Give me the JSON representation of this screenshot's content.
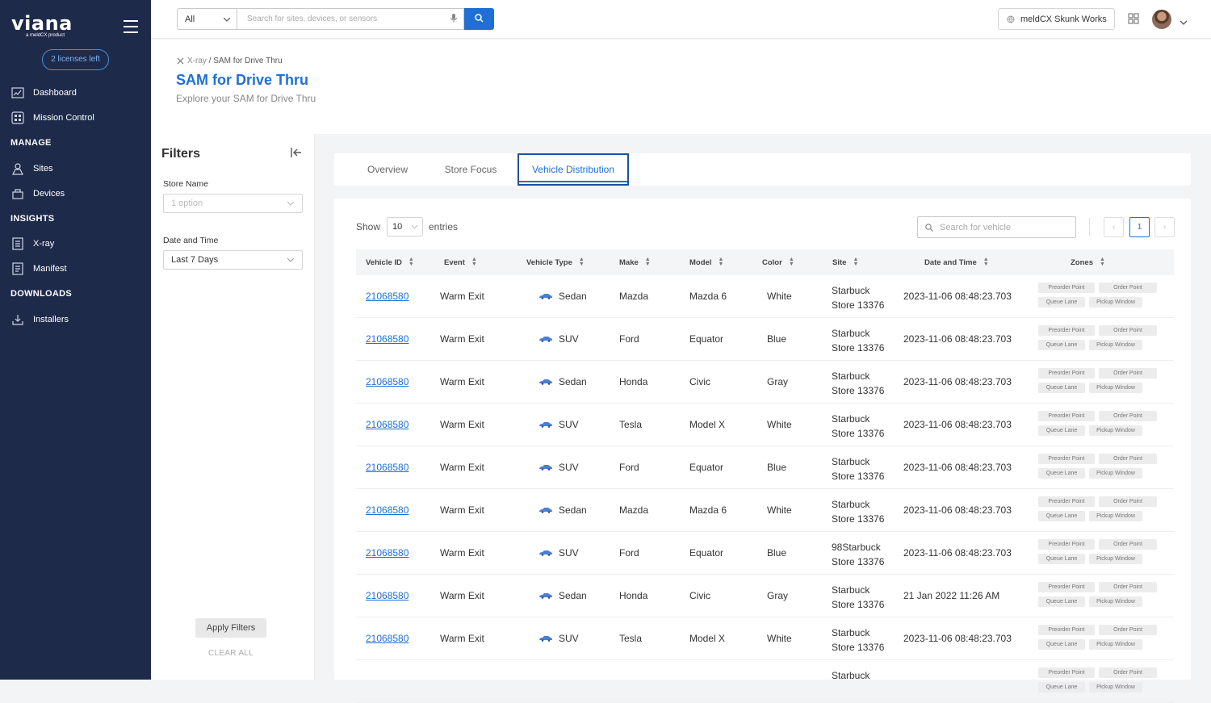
{
  "sidebar": {
    "logo": "viana",
    "logo_sub": "a meldCX product",
    "licenses": "2 licenses left",
    "items_top": [
      {
        "label": "Dashboard",
        "icon": "dashboard-icon"
      },
      {
        "label": "Mission Control",
        "icon": "mission-control-icon"
      }
    ],
    "manage": {
      "title": "MANAGE",
      "items": [
        {
          "label": "Sites",
          "icon": "sites-icon"
        },
        {
          "label": "Devices",
          "icon": "devices-icon"
        }
      ]
    },
    "insights": {
      "title": "INSIGHTS",
      "items": [
        {
          "label": "X-ray",
          "icon": "xray-icon"
        },
        {
          "label": "Manifest",
          "icon": "manifest-icon"
        }
      ]
    },
    "downloads": {
      "title": "DOWNLOADS",
      "items": [
        {
          "label": "Installers",
          "icon": "installers-icon"
        }
      ]
    }
  },
  "topbar": {
    "scope_value": "All",
    "search_placeholder": "Search for sites, devices, or sensors",
    "org_name": "meldCX Skunk Works"
  },
  "header": {
    "breadcrumb_parent": "X-ray",
    "breadcrumb_current": "SAM for Drive Thru",
    "title": "SAM for Drive Thru",
    "subtitle": "Explore your SAM for Drive Thru"
  },
  "filters": {
    "title": "Filters",
    "store_label": "Store Name",
    "store_placeholder": "1 option",
    "date_label": "Date and Time",
    "date_value": "Last 7 Days",
    "apply": "Apply Filters",
    "clear": "CLEAR ALL"
  },
  "tabs": [
    "Overview",
    "Store Focus",
    "Vehicle Distribution"
  ],
  "table": {
    "show": "Show",
    "entries_value": "10",
    "entries": "entries",
    "search_placeholder": "Search for vehicle",
    "page": "1",
    "columns": [
      "Vehicle ID",
      "Event",
      "Vehicle Type",
      "Make",
      "Model",
      "Color",
      "Site",
      "Date and Time",
      "Zones"
    ],
    "zones": [
      "Preorder Point",
      "Order Point",
      "Queue Lane",
      "Pickup Window"
    ],
    "rows": [
      {
        "id": "21068580",
        "event": "Warm Exit",
        "type": "Sedan",
        "make": "Mazda",
        "model": "Mazda 6",
        "color": "White",
        "site1": "Starbuck",
        "site2": "Store 13376",
        "dt": "2023-11-06 08:48:23.703"
      },
      {
        "id": "21068580",
        "event": "Warm Exit",
        "type": "SUV",
        "make": "Ford",
        "model": "Equator",
        "color": "Blue",
        "site1": "Starbuck",
        "site2": "Store 13376",
        "dt": "2023-11-06 08:48:23.703"
      },
      {
        "id": "21068580",
        "event": "Warm Exit",
        "type": "Sedan",
        "make": "Honda",
        "model": "Civic",
        "color": "Gray",
        "site1": "Starbuck",
        "site2": "Store 13376",
        "dt": "2023-11-06 08:48:23.703"
      },
      {
        "id": "21068580",
        "event": "Warm Exit",
        "type": "SUV",
        "make": "Tesla",
        "model": "Model X",
        "color": "White",
        "site1": "Starbuck",
        "site2": "Store 13376",
        "dt": "2023-11-06 08:48:23.703"
      },
      {
        "id": "21068580",
        "event": "Warm Exit",
        "type": "SUV",
        "make": "Ford",
        "model": "Equator",
        "color": "Blue",
        "site1": "Starbuck",
        "site2": "Store 13376",
        "dt": "2023-11-06 08:48:23.703"
      },
      {
        "id": "21068580",
        "event": "Warm Exit",
        "type": "Sedan",
        "make": "Mazda",
        "model": "Mazda 6",
        "color": "White",
        "site1": "Starbuck",
        "site2": "Store 13376",
        "dt": "2023-11-06 08:48:23.703"
      },
      {
        "id": "21068580",
        "event": "Warm Exit",
        "type": "SUV",
        "make": "Ford",
        "model": "Equator",
        "color": "Blue",
        "site1": "98Starbuck",
        "site2": "Store 13376",
        "dt": "2023-11-06 08:48:23.703"
      },
      {
        "id": "21068580",
        "event": "Warm Exit",
        "type": "Sedan",
        "make": "Honda",
        "model": "Civic",
        "color": "Gray",
        "site1": "Starbuck",
        "site2": "Store 13376",
        "dt": "21 Jan 2022  11:26 AM"
      },
      {
        "id": "21068580",
        "event": "Warm Exit",
        "type": "SUV",
        "make": "Tesla",
        "model": "Model X",
        "color": "White",
        "site1": "Starbuck",
        "site2": "Store 13376",
        "dt": "2023-11-06 08:48:23.703"
      },
      {
        "id": "",
        "event": "",
        "type": "",
        "make": "",
        "model": "",
        "color": "",
        "site1": "Starbuck",
        "site2": "",
        "dt": ""
      }
    ]
  }
}
